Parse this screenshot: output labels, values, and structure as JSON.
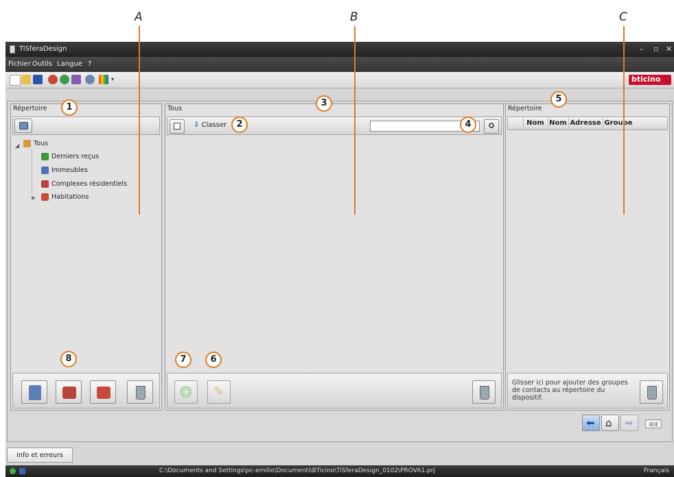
{
  "callouts": {
    "a": "A",
    "b": "B",
    "c": "C"
  },
  "badges": {
    "b1": "1",
    "b2": "2",
    "b3": "3",
    "b4": "4",
    "b5": "5",
    "b6": "6",
    "b7": "7",
    "b8": "8"
  },
  "window": {
    "title": "TiSferaDesign",
    "controls": [
      "–",
      "▫",
      "✕"
    ]
  },
  "menu": [
    "Fichier",
    "Outils",
    "Langue",
    "?"
  ],
  "brand": {
    "logo": "bticino",
    "color": "#c8102e"
  },
  "left_panel": {
    "title": "Répertoire",
    "tree": [
      {
        "label": "Tous",
        "icon": "people-icon",
        "expanded": true
      },
      {
        "label": "Derniers reçus",
        "icon": "recent-icon"
      },
      {
        "label": "Immeubles",
        "icon": "building-icon"
      },
      {
        "label": "Complexes résidentiels",
        "icon": "complex-icon"
      },
      {
        "label": "Habitations",
        "icon": "house-icon",
        "collapsed": true
      }
    ]
  },
  "middle_panel": {
    "title": "Tous",
    "sort_label": "Classer",
    "search": {
      "value": "",
      "placeholder": ""
    }
  },
  "right_panel": {
    "title": "Répertoire",
    "columns": [
      "Nom",
      "Nom",
      "Adresse",
      "Groupe"
    ],
    "drop_hint": "Glisser ici pour ajouter des groupes de contacts au répertoire du dispositif."
  },
  "pager": {
    "label": "4/4"
  },
  "info_button": {
    "label": "Info et erreurs"
  },
  "status": {
    "path": "C:\\Documents and Settings\\pc-emilio\\Documenti\\BTicino\\TiSferaDesign_0102\\PROVA1.prj",
    "language": "Français"
  },
  "colors": {
    "accent": "#e07a1f",
    "titlebar": "#2b2b2b",
    "panel": "#e2e2e2"
  }
}
